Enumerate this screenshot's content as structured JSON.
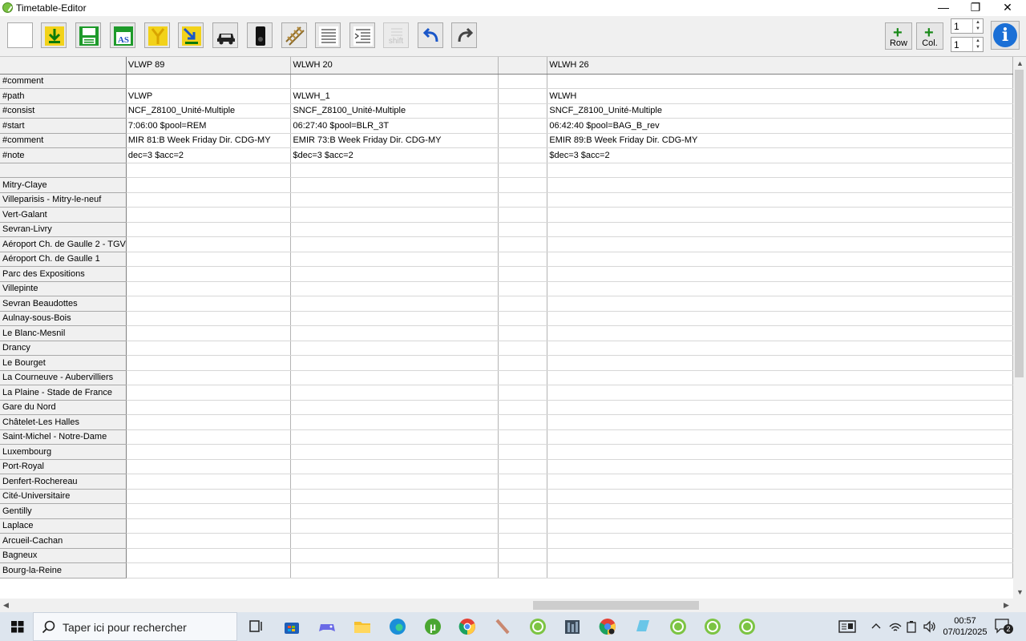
{
  "window": {
    "title": "Timetable-Editor"
  },
  "toolbar": {
    "buttons": [
      "new-blank",
      "import",
      "save",
      "save-as",
      "filter",
      "insert",
      "consist",
      "signal",
      "track",
      "text",
      "indent",
      "shift",
      "undo",
      "redo"
    ],
    "shift_label": "shift",
    "row_label": "Row",
    "col_label": "Col.",
    "row_count": "1",
    "col_count": "1",
    "accent": "#1a8a1a"
  },
  "grid": {
    "columns": [
      "VLWP 89",
      "WLWH 20",
      "",
      "WLWH 26"
    ],
    "rows": [
      {
        "label": "#comment",
        "cells": [
          "",
          "",
          "",
          ""
        ]
      },
      {
        "label": "#path",
        "cells": [
          "VLWP",
          "WLWH_1",
          "",
          "WLWH"
        ]
      },
      {
        "label": "#consist",
        "cells": [
          "NCF_Z8100_Unité-Multiple",
          "SNCF_Z8100_Unité-Multiple",
          "",
          "SNCF_Z8100_Unité-Multiple"
        ]
      },
      {
        "label": "#start",
        "cells": [
          "7:06:00 $pool=REM",
          "06:27:40 $pool=BLR_3T",
          "",
          "06:42:40 $pool=BAG_B_rev"
        ]
      },
      {
        "label": "#comment",
        "cells": [
          "MIR 81:B Week Friday Dir. CDG-MY",
          "EMIR 73:B Week Friday Dir. CDG-MY",
          "",
          "EMIR 89:B Week Friday Dir. CDG-MY"
        ]
      },
      {
        "label": "#note",
        "cells": [
          "dec=3 $acc=2",
          "$dec=3 $acc=2",
          "",
          "$dec=3 $acc=2"
        ]
      },
      {
        "label": "",
        "cells": [
          "",
          "",
          "",
          ""
        ]
      },
      {
        "label": "Mitry-Claye",
        "cells": [
          "",
          "",
          "",
          ""
        ]
      },
      {
        "label": "Villeparisis - Mitry-le-neuf",
        "cells": [
          "",
          "",
          "",
          ""
        ]
      },
      {
        "label": "Vert-Galant",
        "cells": [
          "",
          "",
          "",
          ""
        ]
      },
      {
        "label": "Sevran-Livry",
        "cells": [
          "",
          "",
          "",
          ""
        ]
      },
      {
        "label": "Aéroport Ch. de Gaulle 2 - TGV",
        "cells": [
          "",
          "",
          "",
          ""
        ]
      },
      {
        "label": "Aéroport Ch. de Gaulle 1",
        "cells": [
          "",
          "",
          "",
          ""
        ]
      },
      {
        "label": "Parc des Expositions",
        "cells": [
          "",
          "",
          "",
          ""
        ]
      },
      {
        "label": "Villepinte",
        "cells": [
          "",
          "",
          "",
          ""
        ]
      },
      {
        "label": "Sevran Beaudottes",
        "cells": [
          "",
          "",
          "",
          ""
        ]
      },
      {
        "label": "Aulnay-sous-Bois",
        "cells": [
          "",
          "",
          "",
          ""
        ]
      },
      {
        "label": "Le Blanc-Mesnil",
        "cells": [
          "",
          "",
          "",
          ""
        ]
      },
      {
        "label": "Drancy",
        "cells": [
          "",
          "",
          "",
          ""
        ]
      },
      {
        "label": "Le Bourget",
        "cells": [
          "",
          "",
          "",
          ""
        ]
      },
      {
        "label": "La Courneuve - Aubervilliers",
        "cells": [
          "",
          "",
          "",
          ""
        ]
      },
      {
        "label": "La Plaine - Stade de France",
        "cells": [
          "",
          "",
          "",
          ""
        ]
      },
      {
        "label": "Gare du Nord",
        "cells": [
          "",
          "",
          "",
          ""
        ]
      },
      {
        "label": "Châtelet-Les Halles",
        "cells": [
          "",
          "",
          "",
          ""
        ]
      },
      {
        "label": "Saint-Michel - Notre-Dame",
        "cells": [
          "",
          "",
          "",
          ""
        ]
      },
      {
        "label": "Luxembourg",
        "cells": [
          "",
          "",
          "",
          ""
        ]
      },
      {
        "label": "Port-Royal",
        "cells": [
          "",
          "",
          "",
          ""
        ]
      },
      {
        "label": "Denfert-Rochereau",
        "cells": [
          "",
          "",
          "",
          ""
        ]
      },
      {
        "label": "Cité-Universitaire",
        "cells": [
          "",
          "",
          "",
          ""
        ]
      },
      {
        "label": "Gentilly",
        "cells": [
          "",
          "",
          "",
          ""
        ]
      },
      {
        "label": "Laplace",
        "cells": [
          "",
          "",
          "",
          ""
        ]
      },
      {
        "label": "Arcueil-Cachan",
        "cells": [
          "",
          "",
          "",
          ""
        ]
      },
      {
        "label": "Bagneux",
        "cells": [
          "",
          "",
          "",
          ""
        ]
      },
      {
        "label": "Bourg-la-Reine",
        "cells": [
          "",
          "",
          "",
          ""
        ]
      }
    ]
  },
  "taskbar": {
    "search_placeholder": "Taper ici pour rechercher",
    "time": "00:57",
    "date": "07/01/2025",
    "notifications": "2"
  }
}
